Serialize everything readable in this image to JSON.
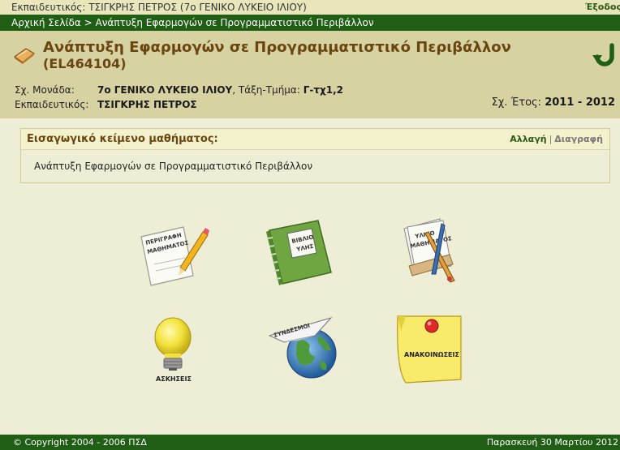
{
  "topbar": {
    "user_text": "Εκπαιδευτικός: ΤΣΙΓΚΡΗΣ ΠΕΤΡΟΣ (7ο ΓΕΝΙΚΟ ΛΥΚΕΙΟ ΙΛΙΟΥ)",
    "logout_label": "Έξοδος"
  },
  "breadcrumb": {
    "home": "Αρχική Σελίδα",
    "separator": " > ",
    "current": "Ανάπτυξη Εφαρμογών σε Προγραμματιστικό Περιβάλλον"
  },
  "course": {
    "title": "Ανάπτυξη Εφαρμογών σε Προγραμματιστικό Περιβάλλον",
    "code": "(EL464104)",
    "school_label": "Σχ. Μονάδα:",
    "school": "7ο ΓΕΝΙΚΟ ΛΥΚΕΙΟ ΙΛΙΟΥ",
    "class_label": ", Τάξη-Τμήμα: ",
    "class": "Γ-τχ1,2",
    "teacher_label": "Εκπαιδευτικός:",
    "teacher": "ΤΣΙΓΚΡΗΣ ΠΕΤΡΟΣ",
    "year_label": "Σχ. Έτος: ",
    "year": "2011 - 2012"
  },
  "intro": {
    "title": "Εισαγωγικό κείμενο μαθήματος:",
    "change_label": "Αλλαγή",
    "sep": "|",
    "delete_label": "Διαγραφή",
    "text": "Ανάπτυξη Εφαρμογών σε Προγραμματιστικό Περιβάλλον"
  },
  "tiles": {
    "description": [
      "ΠΕΡΙΓΡΑΦΗ",
      "ΜΑΘΗΜΑΤΟΣ"
    ],
    "book": [
      "ΒΙΒΛΙΟ",
      "ΥΛΗΣ"
    ],
    "material": [
      "ΥΛΙΚΟ",
      "ΜΑΘΗΜΑΤΟΣ"
    ],
    "exercises": "ΑΣΚΗΣΕΙΣ",
    "links": "ΣΥΝΔΕΣΜΟΙ",
    "announcements": "ΑΝΑΚΟΙΝΩΣΕΙΣ"
  },
  "footer": {
    "copyright": "© Copyright 2004 - 2006 ΠΣΔ",
    "date": "Παρασκευή 30 Μαρτίου 2012"
  },
  "colors": {
    "green": "#1f5e14",
    "brown": "#6b4510",
    "header_bg": "#d6d2a2",
    "page_bg": "#eeeed6"
  }
}
